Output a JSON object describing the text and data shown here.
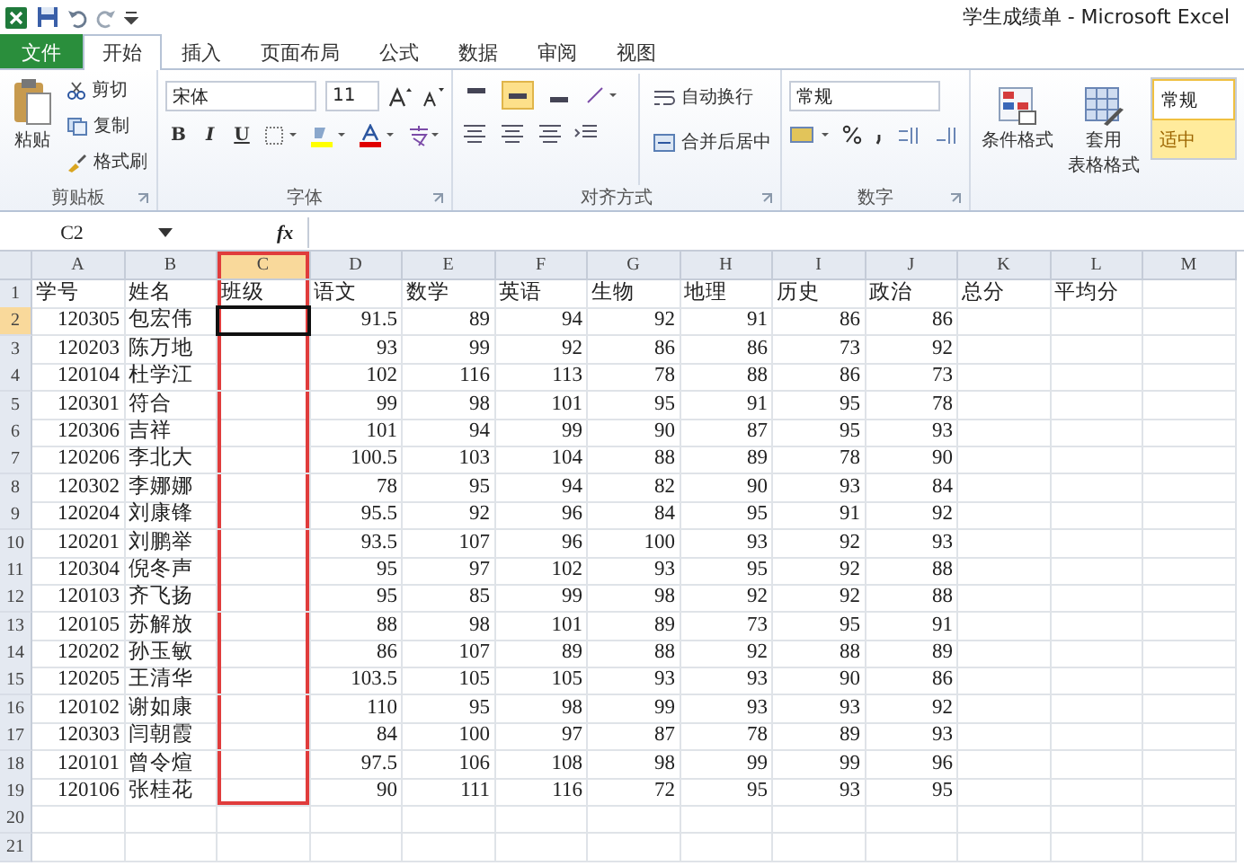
{
  "window": {
    "title": "学生成绩单 - Microsoft Excel"
  },
  "tabs": [
    {
      "label": "文件",
      "kind": "file",
      "selected": false
    },
    {
      "label": "开始",
      "kind": "tab",
      "selected": true
    },
    {
      "label": "插入",
      "kind": "tab",
      "selected": false
    },
    {
      "label": "页面布局",
      "kind": "tab",
      "selected": false
    },
    {
      "label": "公式",
      "kind": "tab",
      "selected": false
    },
    {
      "label": "数据",
      "kind": "tab",
      "selected": false
    },
    {
      "label": "审阅",
      "kind": "tab",
      "selected": false
    },
    {
      "label": "视图",
      "kind": "tab",
      "selected": false
    }
  ],
  "ribbon": {
    "groups": [
      {
        "kind": "clipboard",
        "label": "剪贴板",
        "paste": "粘贴",
        "items": [
          "剪切",
          "复制",
          "格式刷"
        ]
      },
      {
        "kind": "font",
        "label": "字体",
        "font": "宋体",
        "size": "11",
        "styles": [
          "B",
          "I",
          "U"
        ]
      },
      {
        "kind": "align",
        "label": "对齐方式",
        "vertical_align": [
          {
            "selected": false
          },
          {
            "selected": true
          },
          {
            "selected": false
          }
        ],
        "commands": [
          "自动换行",
          "合并后居中"
        ]
      },
      {
        "kind": "number",
        "label": "数字",
        "format": "常规"
      },
      {
        "kind": "styles",
        "buttons": [
          {
            "lines": [
              "条件格式"
            ]
          },
          {
            "lines": [
              "套用",
              "表格格式"
            ]
          }
        ],
        "gallery": [
          {
            "label": "常规",
            "color": "#ffffff"
          },
          {
            "label": "适中",
            "color": "#ffeb9c"
          }
        ]
      }
    ]
  },
  "formula_bar": {
    "name_box": "C2",
    "function_label": "fx"
  },
  "sheet": {
    "columns": [
      {
        "label": "A",
        "selected": false,
        "highlighted": false
      },
      {
        "label": "B",
        "selected": false,
        "highlighted": false
      },
      {
        "label": "C",
        "selected": true,
        "highlighted": true
      },
      {
        "label": "D",
        "selected": false,
        "highlighted": false
      },
      {
        "label": "E",
        "selected": false,
        "highlighted": false
      },
      {
        "label": "F",
        "selected": false,
        "highlighted": false
      },
      {
        "label": "G",
        "selected": false,
        "highlighted": false
      },
      {
        "label": "H",
        "selected": false,
        "highlighted": false
      },
      {
        "label": "I",
        "selected": false,
        "highlighted": false
      },
      {
        "label": "J",
        "selected": false,
        "highlighted": false
      },
      {
        "label": "K",
        "selected": false,
        "highlighted": false
      },
      {
        "label": "L",
        "selected": false,
        "highlighted": false
      },
      {
        "label": "M",
        "selected": false,
        "highlighted": false
      }
    ],
    "rows": [
      {
        "label": "1",
        "selected": false,
        "cells": [
          "学号",
          "姓名",
          "班级",
          "语文",
          "数学",
          "英语",
          "生物",
          "地理",
          "历史",
          "政治",
          "总分",
          "平均分"
        ]
      },
      {
        "label": "2",
        "selected": true,
        "cells": [
          "120305",
          "包宏伟",
          null,
          "91.5",
          "89",
          "94",
          "92",
          "91",
          "86",
          "86"
        ]
      },
      {
        "label": "3",
        "selected": false,
        "cells": [
          "120203",
          "陈万地",
          null,
          "93",
          "99",
          "92",
          "86",
          "86",
          "73",
          "92"
        ]
      },
      {
        "label": "4",
        "selected": false,
        "cells": [
          "120104",
          "杜学江",
          null,
          "102",
          "116",
          "113",
          "78",
          "88",
          "86",
          "73"
        ]
      },
      {
        "label": "5",
        "selected": false,
        "cells": [
          "120301",
          "符合",
          null,
          "99",
          "98",
          "101",
          "95",
          "91",
          "95",
          "78"
        ]
      },
      {
        "label": "6",
        "selected": false,
        "cells": [
          "120306",
          "吉祥",
          null,
          "101",
          "94",
          "99",
          "90",
          "87",
          "95",
          "93"
        ]
      },
      {
        "label": "7",
        "selected": false,
        "cells": [
          "120206",
          "李北大",
          null,
          "100.5",
          "103",
          "104",
          "88",
          "89",
          "78",
          "90"
        ]
      },
      {
        "label": "8",
        "selected": false,
        "cells": [
          "120302",
          "李娜娜",
          null,
          "78",
          "95",
          "94",
          "82",
          "90",
          "93",
          "84"
        ]
      },
      {
        "label": "9",
        "selected": false,
        "cells": [
          "120204",
          "刘康锋",
          null,
          "95.5",
          "92",
          "96",
          "84",
          "95",
          "91",
          "92"
        ]
      },
      {
        "label": "10",
        "selected": false,
        "cells": [
          "120201",
          "刘鹏举",
          null,
          "93.5",
          "107",
          "96",
          "100",
          "93",
          "92",
          "93"
        ]
      },
      {
        "label": "11",
        "selected": false,
        "cells": [
          "120304",
          "倪冬声",
          null,
          "95",
          "97",
          "102",
          "93",
          "95",
          "92",
          "88"
        ]
      },
      {
        "label": "12",
        "selected": false,
        "cells": [
          "120103",
          "齐飞扬",
          null,
          "95",
          "85",
          "99",
          "98",
          "92",
          "92",
          "88"
        ]
      },
      {
        "label": "13",
        "selected": false,
        "cells": [
          "120105",
          "苏解放",
          null,
          "88",
          "98",
          "101",
          "89",
          "73",
          "95",
          "91"
        ]
      },
      {
        "label": "14",
        "selected": false,
        "cells": [
          "120202",
          "孙玉敏",
          null,
          "86",
          "107",
          "89",
          "88",
          "92",
          "88",
          "89"
        ]
      },
      {
        "label": "15",
        "selected": false,
        "cells": [
          "120205",
          "王清华",
          null,
          "103.5",
          "105",
          "105",
          "93",
          "93",
          "90",
          "86"
        ]
      },
      {
        "label": "16",
        "selected": false,
        "cells": [
          "120102",
          "谢如康",
          null,
          "110",
          "95",
          "98",
          "99",
          "93",
          "93",
          "92"
        ]
      },
      {
        "label": "17",
        "selected": false,
        "cells": [
          "120303",
          "闫朝霞",
          null,
          "84",
          "100",
          "97",
          "87",
          "78",
          "89",
          "93"
        ]
      },
      {
        "label": "18",
        "selected": false,
        "cells": [
          "120101",
          "曾令煊",
          null,
          "97.5",
          "106",
          "108",
          "98",
          "99",
          "99",
          "96"
        ]
      },
      {
        "label": "19",
        "selected": false,
        "cells": [
          "120106",
          "张桂花",
          null,
          "90",
          "111",
          "116",
          "72",
          "95",
          "93",
          "95"
        ]
      },
      {
        "label": "20",
        "selected": false
      },
      {
        "label": "21",
        "selected": false
      }
    ]
  }
}
